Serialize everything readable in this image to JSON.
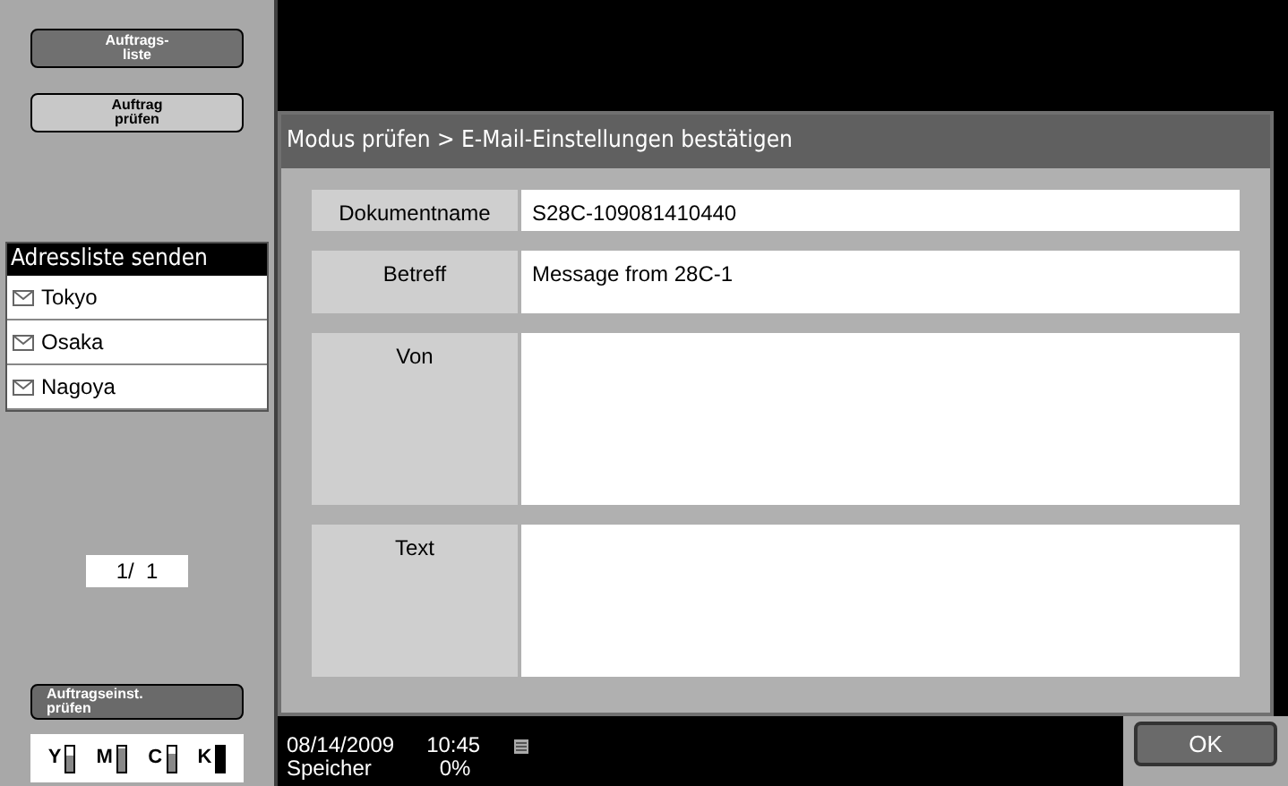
{
  "sidebar": {
    "buttons": [
      {
        "label": "Auftrags-\nliste",
        "selected": true
      },
      {
        "label": "Auftrag\nprüfen",
        "selected": false
      }
    ],
    "address_list": {
      "title": "Adressliste senden",
      "items": [
        "Tokyo",
        "Osaka",
        "Nagoya"
      ]
    },
    "page": "1/  1",
    "bottom_button": "Auftragseinst.\nprüfen",
    "toner": [
      {
        "label": "Y",
        "level": 0.6
      },
      {
        "label": "M",
        "level": 0.9
      },
      {
        "label": "C",
        "level": 0.7
      },
      {
        "label": "K",
        "level": 1
      }
    ]
  },
  "panel": {
    "title": "Modus prüfen > E-Mail-Einstellungen bestätigen",
    "fields": [
      {
        "label": "Dokumentname",
        "value": "S28C-109081410440"
      },
      {
        "label": "Betreff",
        "value": "Message from 28C-1"
      },
      {
        "label": "Von"
      },
      {
        "label": "Text"
      }
    ]
  },
  "status_bar": {
    "date": "08/14/2009",
    "time": "10:45",
    "memory_label": "Speicher",
    "memory": "0%"
  },
  "ok_button": "OK"
}
